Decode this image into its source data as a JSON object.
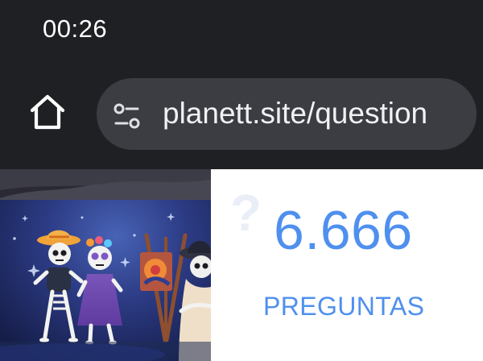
{
  "status_bar": {
    "time": "00:26"
  },
  "browser": {
    "home_icon": "home-icon",
    "address_icon": "tune-icon",
    "url": "planett.site/question"
  },
  "hero_image": {
    "icon": "day-of-the-dead-illustration"
  },
  "stats": {
    "icon": "question-mark-icon",
    "count": "6.666",
    "label": "PREGUNTAS"
  },
  "colors": {
    "background": "#1f2023",
    "omnibox": "#3b3d43",
    "accent_blue": "#4f90ee",
    "white": "#ffffff"
  }
}
